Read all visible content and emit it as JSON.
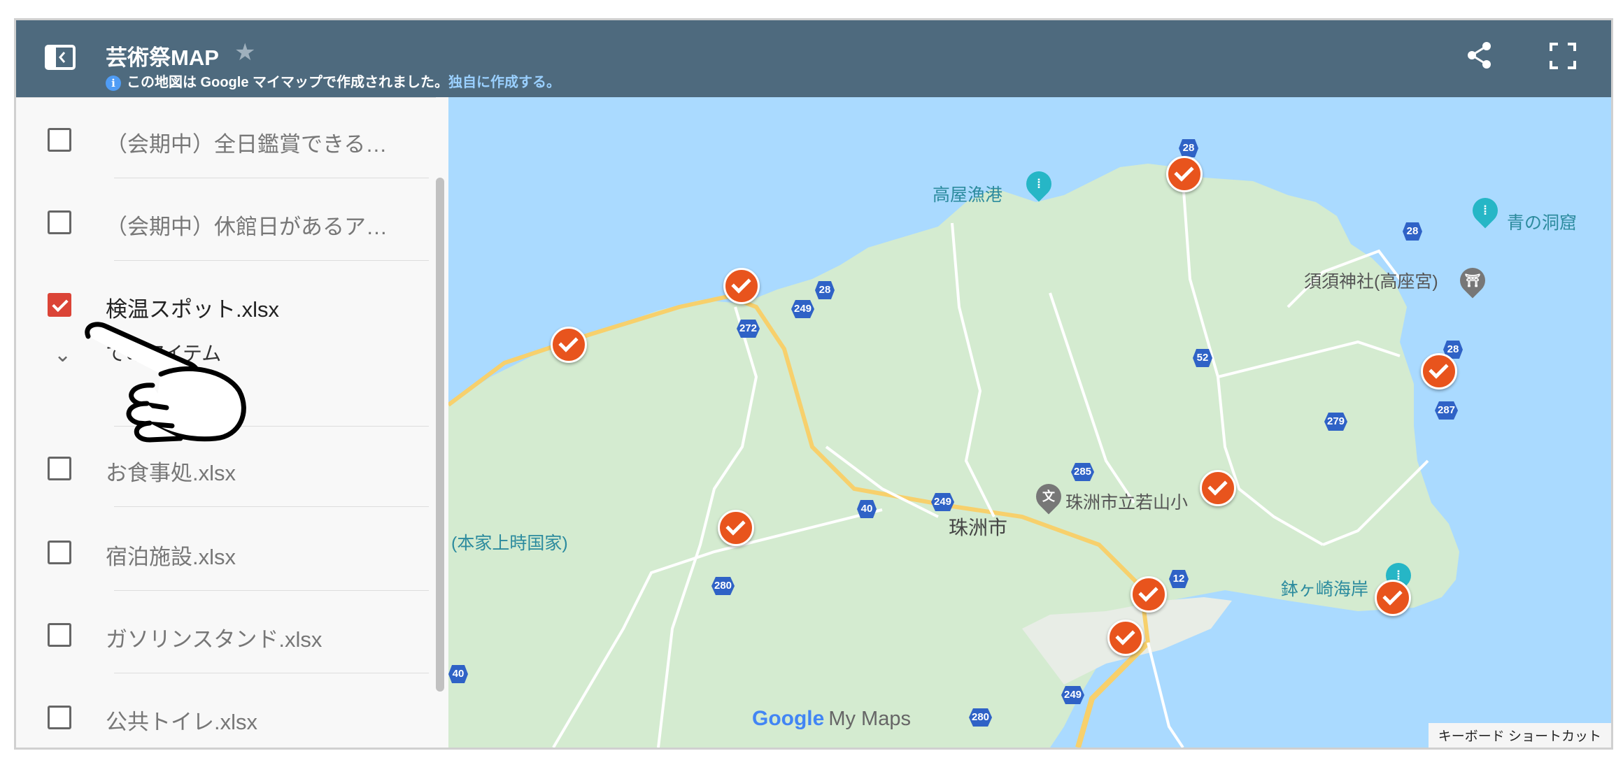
{
  "header": {
    "title": "芸術祭MAP",
    "notice_text": "この地図は Google マイマップで作成されました。",
    "notice_link": "独自に作成する。"
  },
  "layers": [
    {
      "label": "（会期中）全日鑑賞できる…",
      "checked": false
    },
    {
      "label": "（会期中）休館日があるア…",
      "checked": false
    },
    {
      "label": "検温スポット.xlsx",
      "checked": true
    },
    {
      "label": "お食事処.xlsx",
      "checked": false
    },
    {
      "label": "宿泊施設.xlsx",
      "checked": false
    },
    {
      "label": "ガソリンスタンド.xlsx",
      "checked": false
    },
    {
      "label": "公共トイレ.xlsx",
      "checked": false
    }
  ],
  "all_items_label": "てのアイテム",
  "map": {
    "places": {
      "takaya": "高屋漁港",
      "aono": "青の洞窟",
      "suzu_shrine": "須須神社(高座宮)",
      "wakayama": "珠洲市立若山小",
      "suzu_city": "珠洲市",
      "honke": "(本家上時国家)",
      "hachigasaki": "鉢ヶ崎海岸"
    },
    "routes": [
      "28",
      "28",
      "249",
      "272",
      "52",
      "28",
      "279",
      "287",
      "285",
      "249",
      "40",
      "12",
      "280",
      "249",
      "280",
      "40",
      "28"
    ],
    "logo_google": "Google",
    "logo_mymaps": "My Maps",
    "shortcut": "キーボード ショートカット"
  },
  "colors": {
    "header": "#4e6a7e",
    "marker": "#e8541d",
    "sea": "#aadaff",
    "land": "#d4ebd0",
    "checkbox_checked": "#db4437"
  }
}
